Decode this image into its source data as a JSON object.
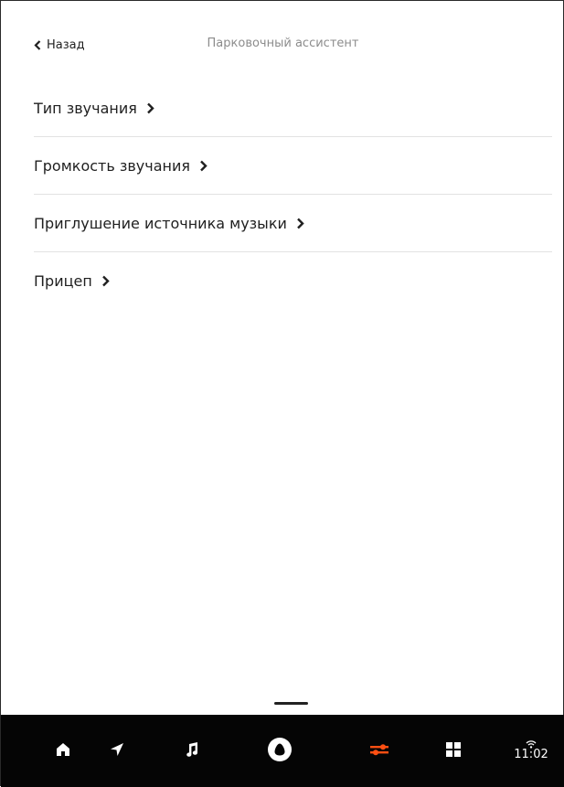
{
  "header": {
    "back_label": "Назад",
    "title": "Парковочный ассистент"
  },
  "menu": {
    "items": [
      {
        "label": "Тип звучания"
      },
      {
        "label": "Громкость звучания"
      },
      {
        "label": "Приглушение источника музыки"
      },
      {
        "label": "Прицеп"
      }
    ]
  },
  "navbar": {
    "items": [
      {
        "icon": "home-icon"
      },
      {
        "icon": "navigation-icon"
      },
      {
        "icon": "music-icon"
      },
      {
        "icon": "alice-icon"
      },
      {
        "icon": "settings-sliders-icon",
        "active": true
      },
      {
        "icon": "apps-grid-icon"
      }
    ],
    "status": {
      "wifi_icon": "wifi-icon",
      "time": "11:02"
    }
  },
  "colors": {
    "accent": "#ff4f12",
    "navbar_bg": "#050505",
    "divider": "#e2e2e2",
    "title_text": "#8c8c8c"
  }
}
